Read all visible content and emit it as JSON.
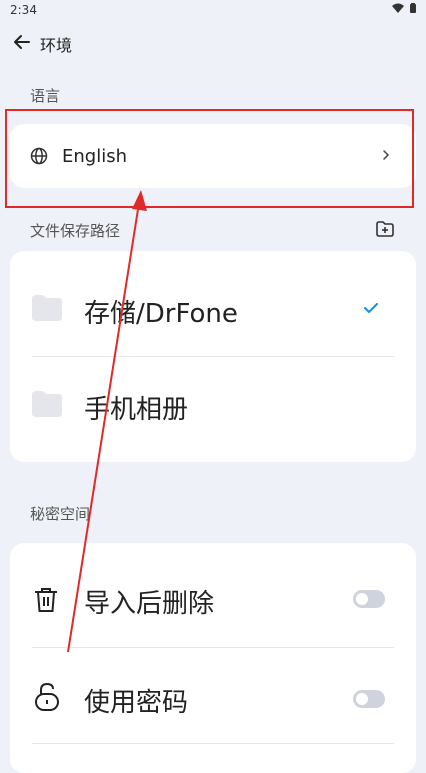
{
  "status_bar": {
    "time": "2:34"
  },
  "header": {
    "title": "环境"
  },
  "language": {
    "section_label": "语言",
    "current": "English"
  },
  "storage": {
    "section_label": "文件保存路径",
    "options": [
      {
        "label": "存储/DrFone",
        "selected": true
      },
      {
        "label": "手机相册",
        "selected": false
      }
    ]
  },
  "private_space": {
    "section_label": "秘密空间",
    "settings": [
      {
        "label": "导入后删除",
        "enabled": false
      },
      {
        "label": "使用密码",
        "enabled": false
      }
    ]
  },
  "icons": {
    "back": "arrow-left-icon",
    "language": "globe-icon",
    "chevron": "chevron-right-icon",
    "add_folder": "folder-add-icon",
    "folder": "folder-icon",
    "check": "check-icon",
    "delete": "trash-icon",
    "password": "unlock-icon"
  },
  "colors": {
    "accent": "#1a8fe3",
    "highlight": "#e02a2a",
    "background": "#eef1f7",
    "toggle_off": "#cfd3dd"
  }
}
